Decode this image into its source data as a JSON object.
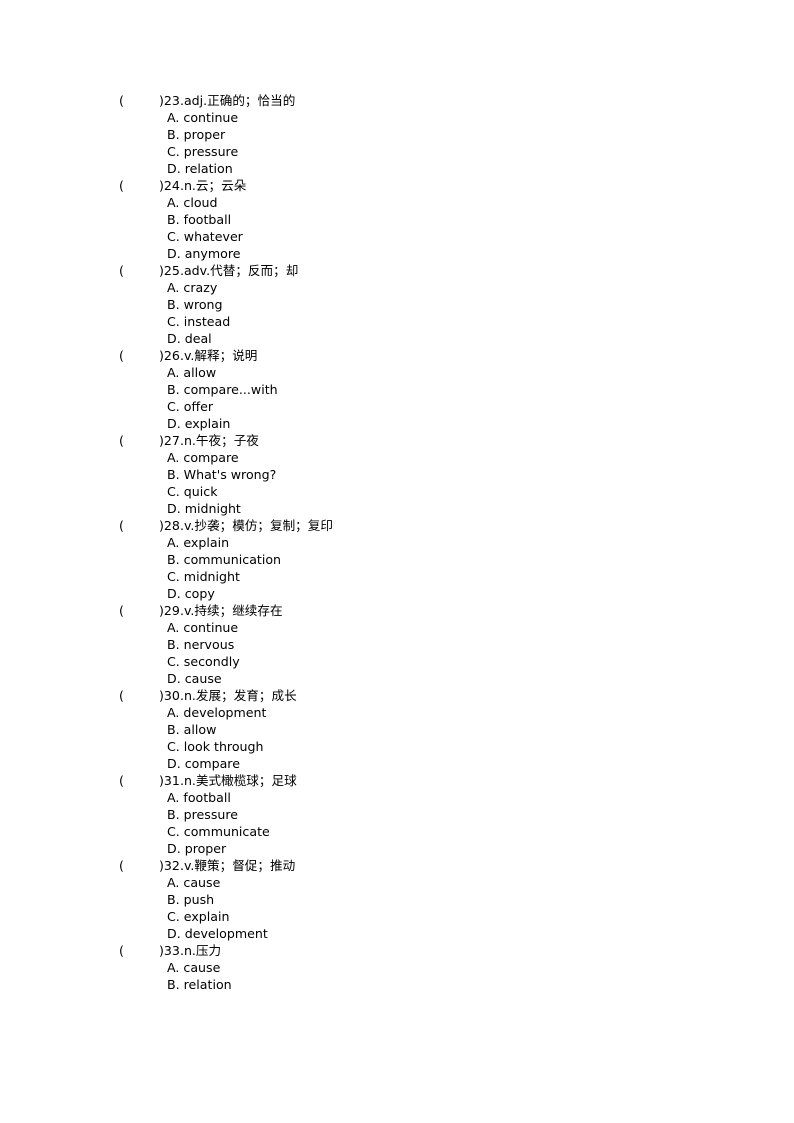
{
  "document": {
    "type": "vocabulary-multiple-choice-worksheet",
    "paren_open": "(",
    "paren_close": ")"
  },
  "questions": [
    {
      "number": "23",
      "stem": ")23.adj.正确的；恰当的",
      "options": [
        "A. continue",
        "B. proper",
        "C. pressure",
        "D. relation"
      ]
    },
    {
      "number": "24",
      "stem": ")24.n.云；云朵",
      "options": [
        "A. cloud",
        "B. football",
        "C. whatever",
        "D. anymore"
      ]
    },
    {
      "number": "25",
      "stem": ")25.adv.代替；反而；却",
      "options": [
        "A. crazy",
        "B. wrong",
        "C. instead",
        "D. deal"
      ]
    },
    {
      "number": "26",
      "stem": ")26.v.解释；说明",
      "options": [
        "A. allow",
        "B. compare...with",
        "C. offer",
        "D. explain"
      ]
    },
    {
      "number": "27",
      "stem": ")27.n.午夜；子夜",
      "options": [
        "A. compare",
        "B. What's wrong?",
        "C. quick",
        "D. midnight"
      ]
    },
    {
      "number": "28",
      "stem": ")28.v.抄袭；模仿；复制；复印",
      "options": [
        "A. explain",
        "B. communication",
        "C. midnight",
        "D. copy"
      ]
    },
    {
      "number": "29",
      "stem": ")29.v.持续；继续存在",
      "options": [
        "A. continue",
        "B. nervous",
        "C. secondly",
        "D. cause"
      ]
    },
    {
      "number": "30",
      "stem": ")30.n.发展；发育；成长",
      "options": [
        "A. development",
        "B. allow",
        "C. look through",
        "D. compare"
      ]
    },
    {
      "number": "31",
      "stem": ")31.n.美式橄榄球；足球",
      "options": [
        "A. football",
        "B. pressure",
        "C. communicate",
        "D. proper"
      ]
    },
    {
      "number": "32",
      "stem": ")32.v.鞭策；督促；推动",
      "options": [
        "A. cause",
        "B. push",
        "C. explain",
        "D. development"
      ]
    },
    {
      "number": "33",
      "stem": ")33.n.压力",
      "options": [
        "A. cause",
        "B. relation"
      ]
    }
  ]
}
